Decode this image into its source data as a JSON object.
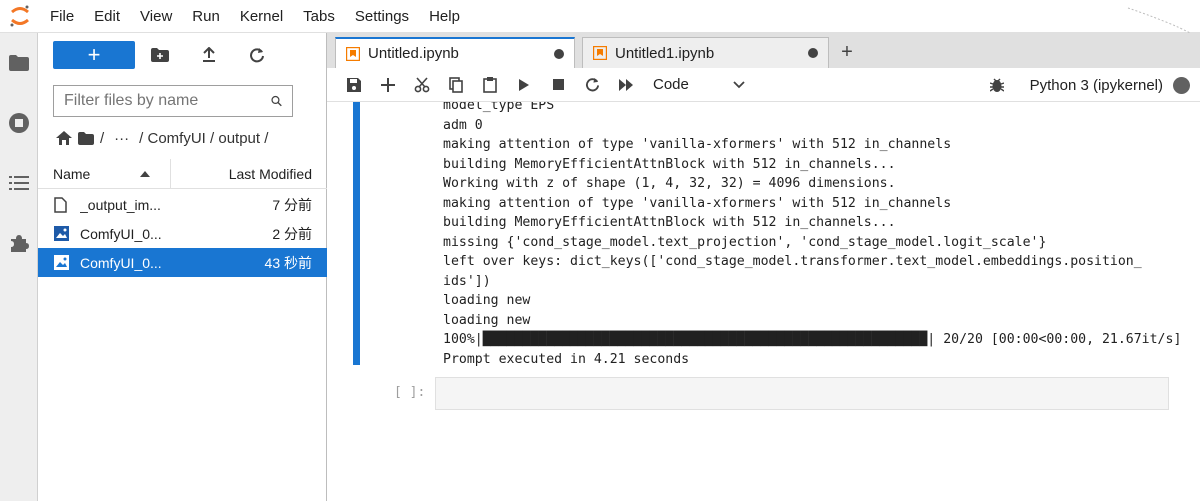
{
  "menu": [
    "File",
    "Edit",
    "View",
    "Run",
    "Kernel",
    "Tabs",
    "Settings",
    "Help"
  ],
  "filebrowser": {
    "new_label": "+",
    "search_placeholder": "Filter files by name",
    "breadcrumb": {
      "ellipsis": "···",
      "path": "/ ComfyUI / output /",
      "sep": "/"
    },
    "col_name": "Name",
    "col_modified": "Last Modified",
    "files": [
      {
        "name": "_output_im...",
        "modified": "7 分前",
        "icon": "file-icon",
        "selected": false
      },
      {
        "name": "ComfyUI_0...",
        "modified": "2 分前",
        "icon": "image-icon",
        "selected": false
      },
      {
        "name": "ComfyUI_0...",
        "modified": "43 秒前",
        "icon": "image-icon",
        "selected": true
      }
    ]
  },
  "tabs": [
    {
      "label": "Untitled.ipynb",
      "active": true
    },
    {
      "label": "Untitled1.ipynb",
      "active": false
    }
  ],
  "toolbar": {
    "cell_type": "Code",
    "kernel_name": "Python 3 (ipykernel)"
  },
  "output_lines": [
    "model_type EPS",
    "adm 0",
    "making attention of type 'vanilla-xformers' with 512 in_channels",
    "building MemoryEfficientAttnBlock with 512 in_channels...",
    "Working with z of shape (1, 4, 32, 32) = 4096 dimensions.",
    "making attention of type 'vanilla-xformers' with 512 in_channels",
    "building MemoryEfficientAttnBlock with 512 in_channels...",
    "missing {'cond_stage_model.text_projection', 'cond_stage_model.logit_scale'}",
    "left over keys: dict_keys(['cond_stage_model.transformer.text_model.embeddings.position_",
    "ids'])",
    "loading new",
    "loading new",
    "100%|████████████████████████████████████████████████████████| 20/20 [00:00<00:00, 21.67it/s]",
    "Prompt executed in 4.21 seconds"
  ],
  "empty_cell_prompt": "[ ]:",
  "colors": {
    "accent": "#1976d2",
    "tab_icon": "#f57c00"
  }
}
